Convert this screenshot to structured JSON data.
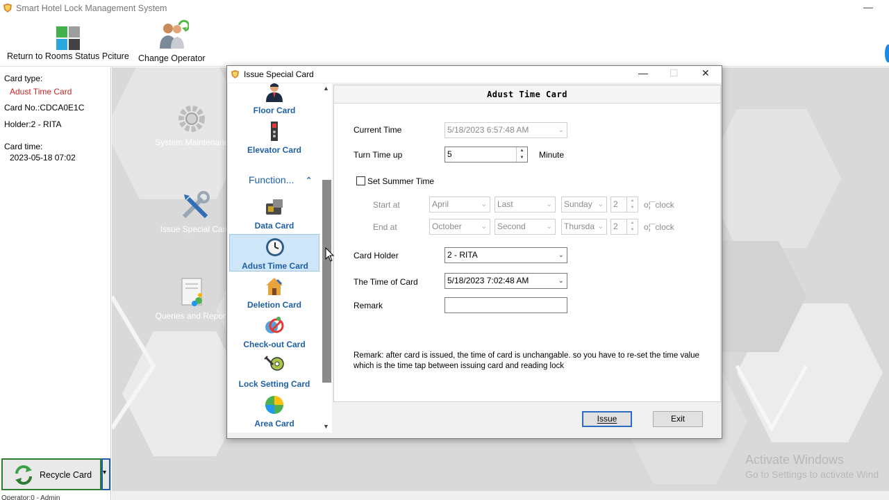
{
  "app": {
    "title": "Smart Hotel Lock Management System",
    "minimize": "—",
    "logo_icon": "shield-logo-icon"
  },
  "toolbar": {
    "return_label": "Return to Rooms Status Pciture",
    "operator_label": "Change Operator"
  },
  "left_panel": {
    "card_type_label": "Card type:",
    "card_type_value": "Adust Time Card",
    "card_no": "Card No.:CDCA0E1C",
    "holder": "Holder:2 - RITA",
    "card_time_label": "Card time:",
    "card_time_value": "2023-05-18 07:02",
    "recycle_label": "Recycle Card",
    "recycle_dropdown": "▾",
    "operator": "Operator:0 - Admin"
  },
  "background": {
    "system_maintenance": "System Maintenanc",
    "issue_special_card": "Issue Special Card",
    "queries_reports": "Queries and Report",
    "activate_title": "Activate Windows",
    "activate_sub": "Go to Settings to activate Wind"
  },
  "dialog": {
    "title": "Issue Special Card",
    "min": "—",
    "max": "☐",
    "close": "✕",
    "sidebar": {
      "items_top": [
        {
          "label": "Floor Card",
          "icon": "floor-card-icon"
        },
        {
          "label": "Elevator Card",
          "icon": "elevator-card-icon"
        }
      ],
      "group_label": "Function...",
      "group_toggle": "⌃",
      "items": [
        {
          "label": "Data Card",
          "icon": "data-card-icon"
        },
        {
          "label": "Adust Time Card",
          "icon": "clock-icon"
        },
        {
          "label": "Deletion Card",
          "icon": "deletion-card-icon"
        },
        {
          "label": "Check-out Card",
          "icon": "check-out-card-icon"
        },
        {
          "label": "Lock Setting Card",
          "icon": "lock-setting-card-icon"
        },
        {
          "label": "Area Card",
          "icon": "area-card-icon"
        }
      ],
      "scroll_up": "▲",
      "scroll_down": "▼"
    },
    "content": {
      "header": "Adust Time Card",
      "current_time_label": "Current Time",
      "current_time_value": "5/18/2023 6:57:48 AM",
      "turn_time_label": "Turn Time up",
      "turn_time_value": "5",
      "turn_time_unit": "Minute",
      "summer_time_label": "Set Summer Time",
      "start_label": "Start at",
      "start_month": "April",
      "start_week": "Last",
      "start_day": "Sunday",
      "start_hour": "2",
      "end_label": "End at",
      "end_month": "October",
      "end_week": "Second",
      "end_day": "Thursda",
      "end_hour": "2",
      "oclock": "o¦¯clock",
      "card_holder_label": "Card Holder",
      "card_holder_value": "2 - RITA",
      "time_of_card_label": "The Time of Card",
      "time_of_card_value": "5/18/2023 7:02:48 AM",
      "remark_label": "Remark",
      "remark_value": "",
      "remark_note": "Remark: after card is issued, the time of card is unchangable. so you have to re-set the time value which is the time tap between issuing card and reading lock"
    },
    "buttons": {
      "issue": "Issue",
      "exit": "Exit"
    }
  }
}
